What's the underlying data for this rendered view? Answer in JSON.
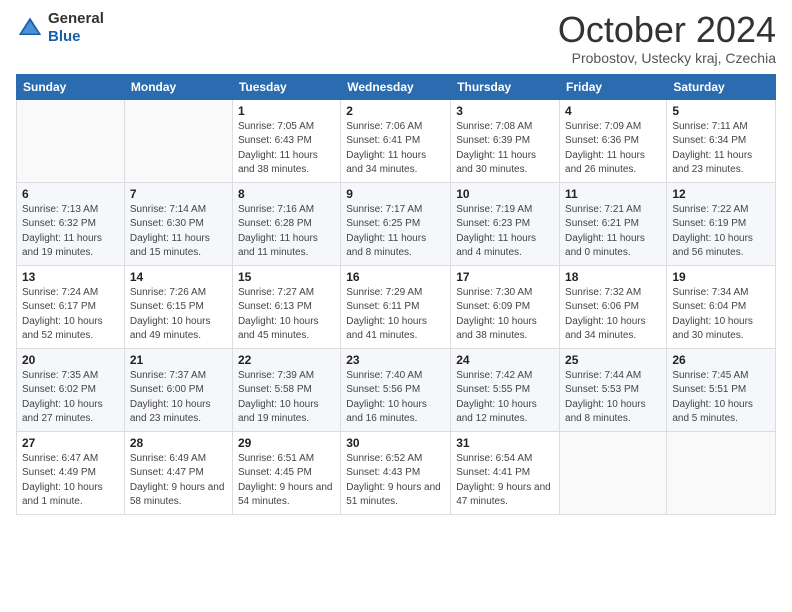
{
  "header": {
    "logo_general": "General",
    "logo_blue": "Blue",
    "month_title": "October 2024",
    "subtitle": "Probostov, Ustecky kraj, Czechia"
  },
  "weekdays": [
    "Sunday",
    "Monday",
    "Tuesday",
    "Wednesday",
    "Thursday",
    "Friday",
    "Saturday"
  ],
  "weeks": [
    [
      {
        "day": "",
        "sunrise": "",
        "sunset": "",
        "daylight": ""
      },
      {
        "day": "",
        "sunrise": "",
        "sunset": "",
        "daylight": ""
      },
      {
        "day": "1",
        "sunrise": "Sunrise: 7:05 AM",
        "sunset": "Sunset: 6:43 PM",
        "daylight": "Daylight: 11 hours and 38 minutes."
      },
      {
        "day": "2",
        "sunrise": "Sunrise: 7:06 AM",
        "sunset": "Sunset: 6:41 PM",
        "daylight": "Daylight: 11 hours and 34 minutes."
      },
      {
        "day": "3",
        "sunrise": "Sunrise: 7:08 AM",
        "sunset": "Sunset: 6:39 PM",
        "daylight": "Daylight: 11 hours and 30 minutes."
      },
      {
        "day": "4",
        "sunrise": "Sunrise: 7:09 AM",
        "sunset": "Sunset: 6:36 PM",
        "daylight": "Daylight: 11 hours and 26 minutes."
      },
      {
        "day": "5",
        "sunrise": "Sunrise: 7:11 AM",
        "sunset": "Sunset: 6:34 PM",
        "daylight": "Daylight: 11 hours and 23 minutes."
      }
    ],
    [
      {
        "day": "6",
        "sunrise": "Sunrise: 7:13 AM",
        "sunset": "Sunset: 6:32 PM",
        "daylight": "Daylight: 11 hours and 19 minutes."
      },
      {
        "day": "7",
        "sunrise": "Sunrise: 7:14 AM",
        "sunset": "Sunset: 6:30 PM",
        "daylight": "Daylight: 11 hours and 15 minutes."
      },
      {
        "day": "8",
        "sunrise": "Sunrise: 7:16 AM",
        "sunset": "Sunset: 6:28 PM",
        "daylight": "Daylight: 11 hours and 11 minutes."
      },
      {
        "day": "9",
        "sunrise": "Sunrise: 7:17 AM",
        "sunset": "Sunset: 6:25 PM",
        "daylight": "Daylight: 11 hours and 8 minutes."
      },
      {
        "day": "10",
        "sunrise": "Sunrise: 7:19 AM",
        "sunset": "Sunset: 6:23 PM",
        "daylight": "Daylight: 11 hours and 4 minutes."
      },
      {
        "day": "11",
        "sunrise": "Sunrise: 7:21 AM",
        "sunset": "Sunset: 6:21 PM",
        "daylight": "Daylight: 11 hours and 0 minutes."
      },
      {
        "day": "12",
        "sunrise": "Sunrise: 7:22 AM",
        "sunset": "Sunset: 6:19 PM",
        "daylight": "Daylight: 10 hours and 56 minutes."
      }
    ],
    [
      {
        "day": "13",
        "sunrise": "Sunrise: 7:24 AM",
        "sunset": "Sunset: 6:17 PM",
        "daylight": "Daylight: 10 hours and 52 minutes."
      },
      {
        "day": "14",
        "sunrise": "Sunrise: 7:26 AM",
        "sunset": "Sunset: 6:15 PM",
        "daylight": "Daylight: 10 hours and 49 minutes."
      },
      {
        "day": "15",
        "sunrise": "Sunrise: 7:27 AM",
        "sunset": "Sunset: 6:13 PM",
        "daylight": "Daylight: 10 hours and 45 minutes."
      },
      {
        "day": "16",
        "sunrise": "Sunrise: 7:29 AM",
        "sunset": "Sunset: 6:11 PM",
        "daylight": "Daylight: 10 hours and 41 minutes."
      },
      {
        "day": "17",
        "sunrise": "Sunrise: 7:30 AM",
        "sunset": "Sunset: 6:09 PM",
        "daylight": "Daylight: 10 hours and 38 minutes."
      },
      {
        "day": "18",
        "sunrise": "Sunrise: 7:32 AM",
        "sunset": "Sunset: 6:06 PM",
        "daylight": "Daylight: 10 hours and 34 minutes."
      },
      {
        "day": "19",
        "sunrise": "Sunrise: 7:34 AM",
        "sunset": "Sunset: 6:04 PM",
        "daylight": "Daylight: 10 hours and 30 minutes."
      }
    ],
    [
      {
        "day": "20",
        "sunrise": "Sunrise: 7:35 AM",
        "sunset": "Sunset: 6:02 PM",
        "daylight": "Daylight: 10 hours and 27 minutes."
      },
      {
        "day": "21",
        "sunrise": "Sunrise: 7:37 AM",
        "sunset": "Sunset: 6:00 PM",
        "daylight": "Daylight: 10 hours and 23 minutes."
      },
      {
        "day": "22",
        "sunrise": "Sunrise: 7:39 AM",
        "sunset": "Sunset: 5:58 PM",
        "daylight": "Daylight: 10 hours and 19 minutes."
      },
      {
        "day": "23",
        "sunrise": "Sunrise: 7:40 AM",
        "sunset": "Sunset: 5:56 PM",
        "daylight": "Daylight: 10 hours and 16 minutes."
      },
      {
        "day": "24",
        "sunrise": "Sunrise: 7:42 AM",
        "sunset": "Sunset: 5:55 PM",
        "daylight": "Daylight: 10 hours and 12 minutes."
      },
      {
        "day": "25",
        "sunrise": "Sunrise: 7:44 AM",
        "sunset": "Sunset: 5:53 PM",
        "daylight": "Daylight: 10 hours and 8 minutes."
      },
      {
        "day": "26",
        "sunrise": "Sunrise: 7:45 AM",
        "sunset": "Sunset: 5:51 PM",
        "daylight": "Daylight: 10 hours and 5 minutes."
      }
    ],
    [
      {
        "day": "27",
        "sunrise": "Sunrise: 6:47 AM",
        "sunset": "Sunset: 4:49 PM",
        "daylight": "Daylight: 10 hours and 1 minute."
      },
      {
        "day": "28",
        "sunrise": "Sunrise: 6:49 AM",
        "sunset": "Sunset: 4:47 PM",
        "daylight": "Daylight: 9 hours and 58 minutes."
      },
      {
        "day": "29",
        "sunrise": "Sunrise: 6:51 AM",
        "sunset": "Sunset: 4:45 PM",
        "daylight": "Daylight: 9 hours and 54 minutes."
      },
      {
        "day": "30",
        "sunrise": "Sunrise: 6:52 AM",
        "sunset": "Sunset: 4:43 PM",
        "daylight": "Daylight: 9 hours and 51 minutes."
      },
      {
        "day": "31",
        "sunrise": "Sunrise: 6:54 AM",
        "sunset": "Sunset: 4:41 PM",
        "daylight": "Daylight: 9 hours and 47 minutes."
      },
      {
        "day": "",
        "sunrise": "",
        "sunset": "",
        "daylight": ""
      },
      {
        "day": "",
        "sunrise": "",
        "sunset": "",
        "daylight": ""
      }
    ]
  ]
}
